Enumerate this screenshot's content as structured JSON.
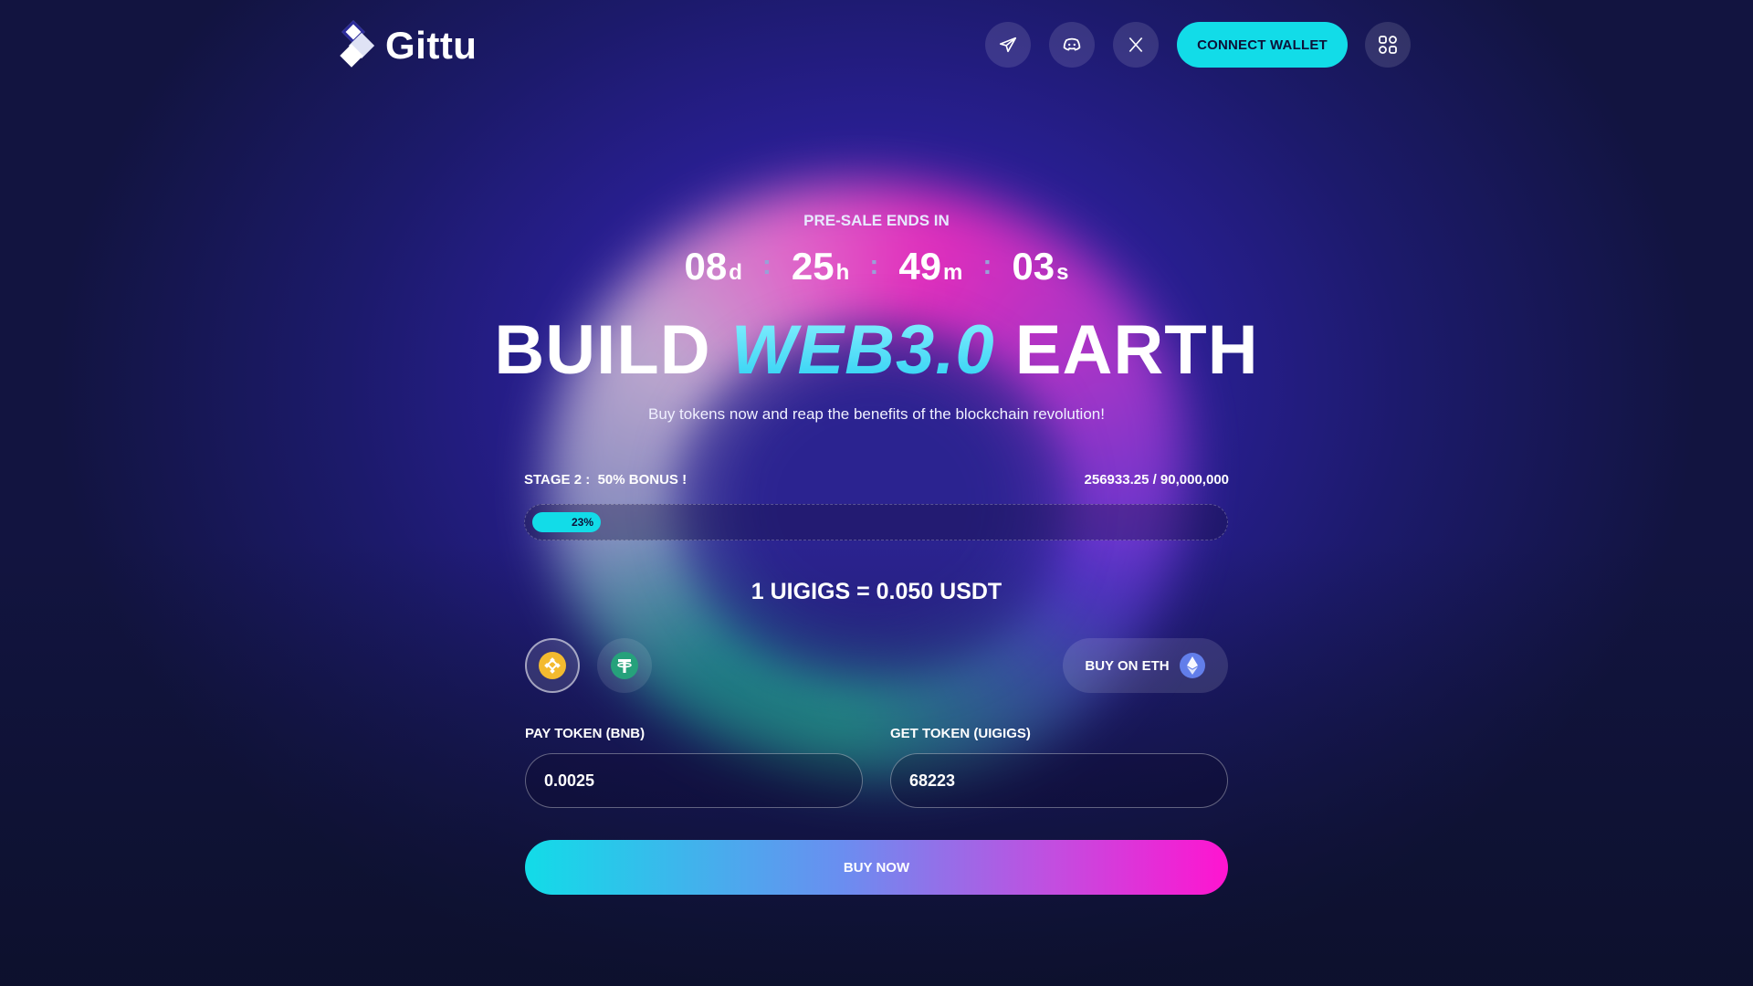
{
  "header": {
    "logo_text": "Gittu",
    "social": [
      {
        "icon": "telegram-icon"
      },
      {
        "icon": "discord-icon"
      },
      {
        "icon": "x-icon"
      }
    ],
    "connect_label": "CONNECT WALLET",
    "menu_icon": "apps-grid-icon"
  },
  "hero": {
    "presale_label": "PRE-SALE ENDS IN",
    "countdown": {
      "days": "08",
      "days_suffix": "d",
      "hours": "25",
      "hours_suffix": "h",
      "minutes": "49",
      "minutes_suffix": "m",
      "seconds": "03",
      "seconds_suffix": "s",
      "separator": ":"
    },
    "headline_pre": "BUILD ",
    "headline_accent": "WEB3.0",
    "headline_post": " EARTH",
    "subtitle": "Buy tokens now and reap the benefits of the blockchain revolution!"
  },
  "stage": {
    "label": "STAGE 2 :  50% BONUS !",
    "count": "256933.25 / 90,000,000",
    "progress_percent": 23,
    "progress_label": "23%"
  },
  "rate": "1 UIGIGS = 0.050 USDT",
  "payment": {
    "coins": [
      {
        "icon": "bnb-icon",
        "selected": true
      },
      {
        "icon": "usdt-icon",
        "selected": false
      }
    ],
    "buy_eth_label": "BUY ON ETH",
    "buy_eth_icon": "ethereum-icon"
  },
  "form": {
    "pay_label": "PAY TOKEN  (BNB)",
    "pay_value": "0.0025",
    "get_label": "GET TOKEN  (UIGIGS)",
    "get_value": "68223",
    "buy_now_label": "BUY NOW"
  },
  "colors": {
    "accent": "#12dce8",
    "magenta": "#ff14d0",
    "bg": "#2a1f96"
  }
}
